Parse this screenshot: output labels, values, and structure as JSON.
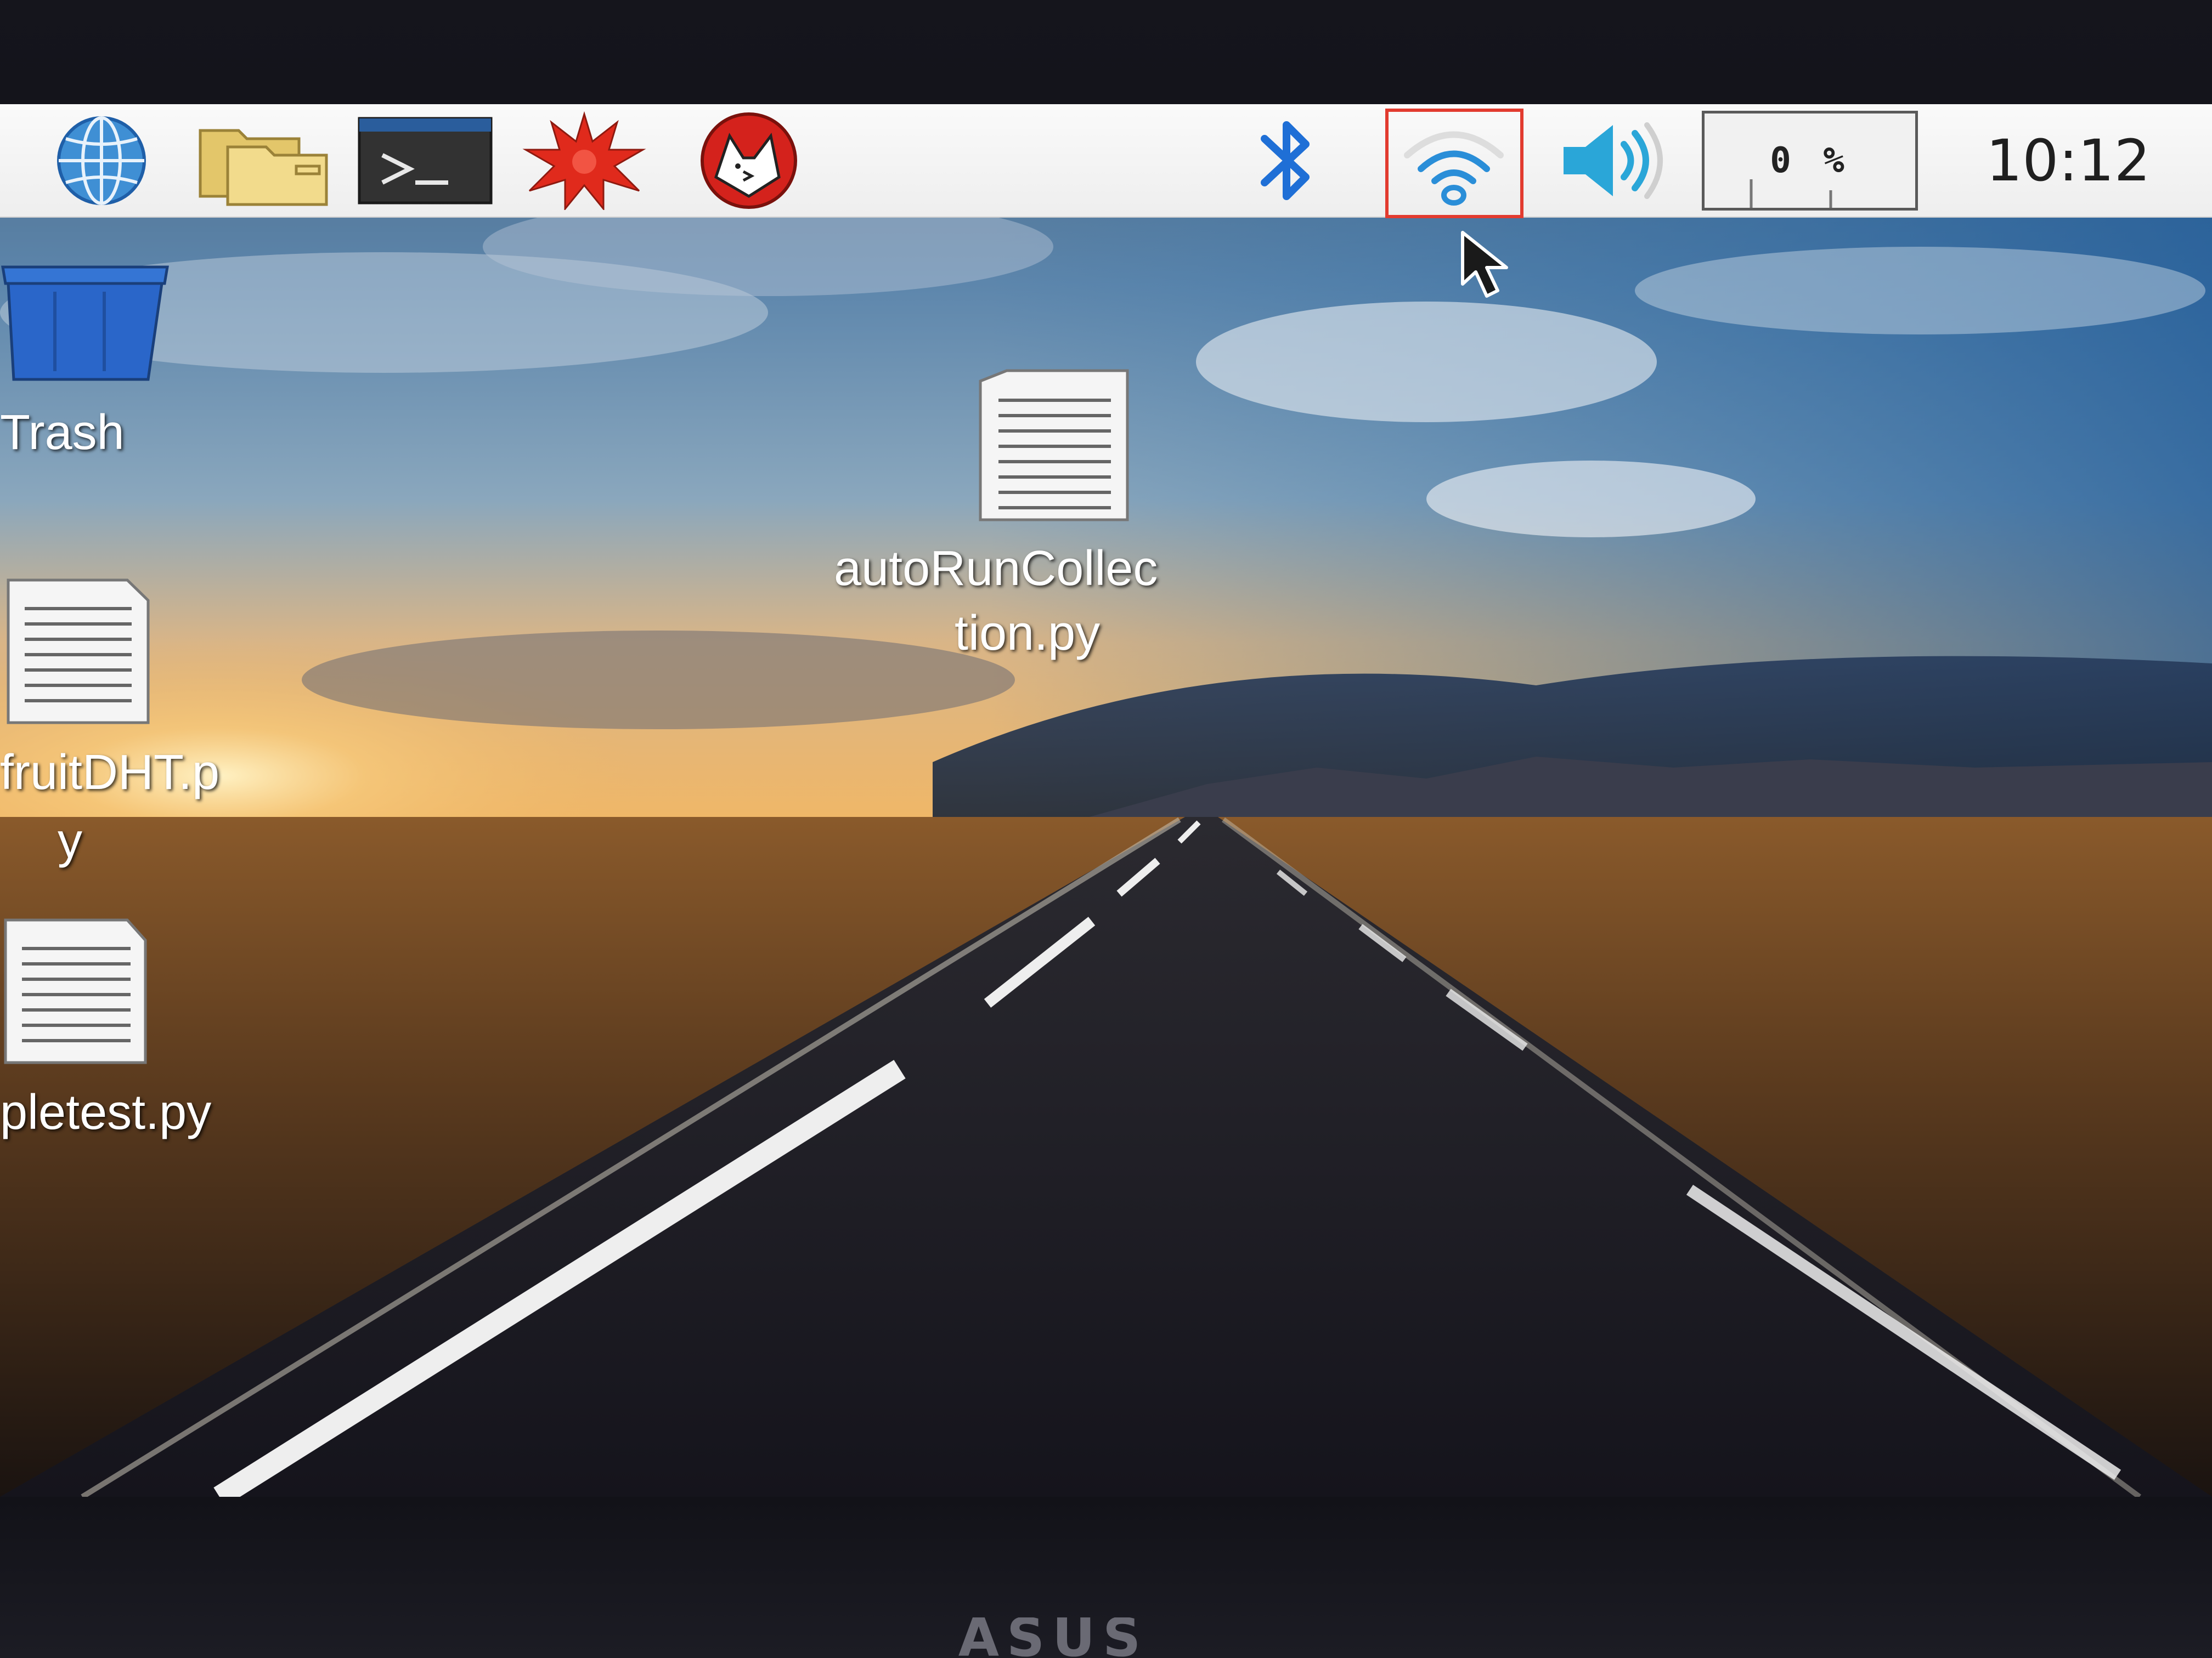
{
  "taskbar": {
    "launchers": [
      {
        "icon": "globe-icon",
        "name": "web-browser"
      },
      {
        "icon": "folder-icon",
        "name": "file-manager"
      },
      {
        "icon": "terminal-icon",
        "name": "terminal"
      },
      {
        "icon": "red-burst-icon",
        "name": "mathematica"
      },
      {
        "icon": "wolf-icon",
        "name": "wolfram"
      }
    ],
    "tray": {
      "bluetooth_icon": "bluetooth-icon",
      "wifi_icon": "wifi-icon",
      "volume_icon": "volume-icon",
      "cpu_usage": "0 %",
      "clock": "10:12"
    },
    "highlight_color": "#e23b2f"
  },
  "desktop": {
    "icons": [
      {
        "name": "trash",
        "label": "Trash",
        "icon": "trash-icon"
      },
      {
        "name": "file-fruitdht",
        "label_lines": [
          "fruitDHT.p",
          "y"
        ],
        "icon": "text-file-icon"
      },
      {
        "name": "file-simpletest",
        "label": "pletest.py",
        "icon": "text-file-icon"
      },
      {
        "name": "file-autorun",
        "label_lines": [
          "autoRunCollec",
          "tion.py"
        ],
        "icon": "text-file-icon"
      }
    ]
  },
  "monitor": {
    "brand": "ASUS"
  },
  "colors": {
    "taskbar_bg": "#f2f2f2",
    "bluetooth_blue": "#1f6fd6",
    "wifi_blue": "#2a8ed8",
    "trash_blue": "#2a66c9"
  }
}
